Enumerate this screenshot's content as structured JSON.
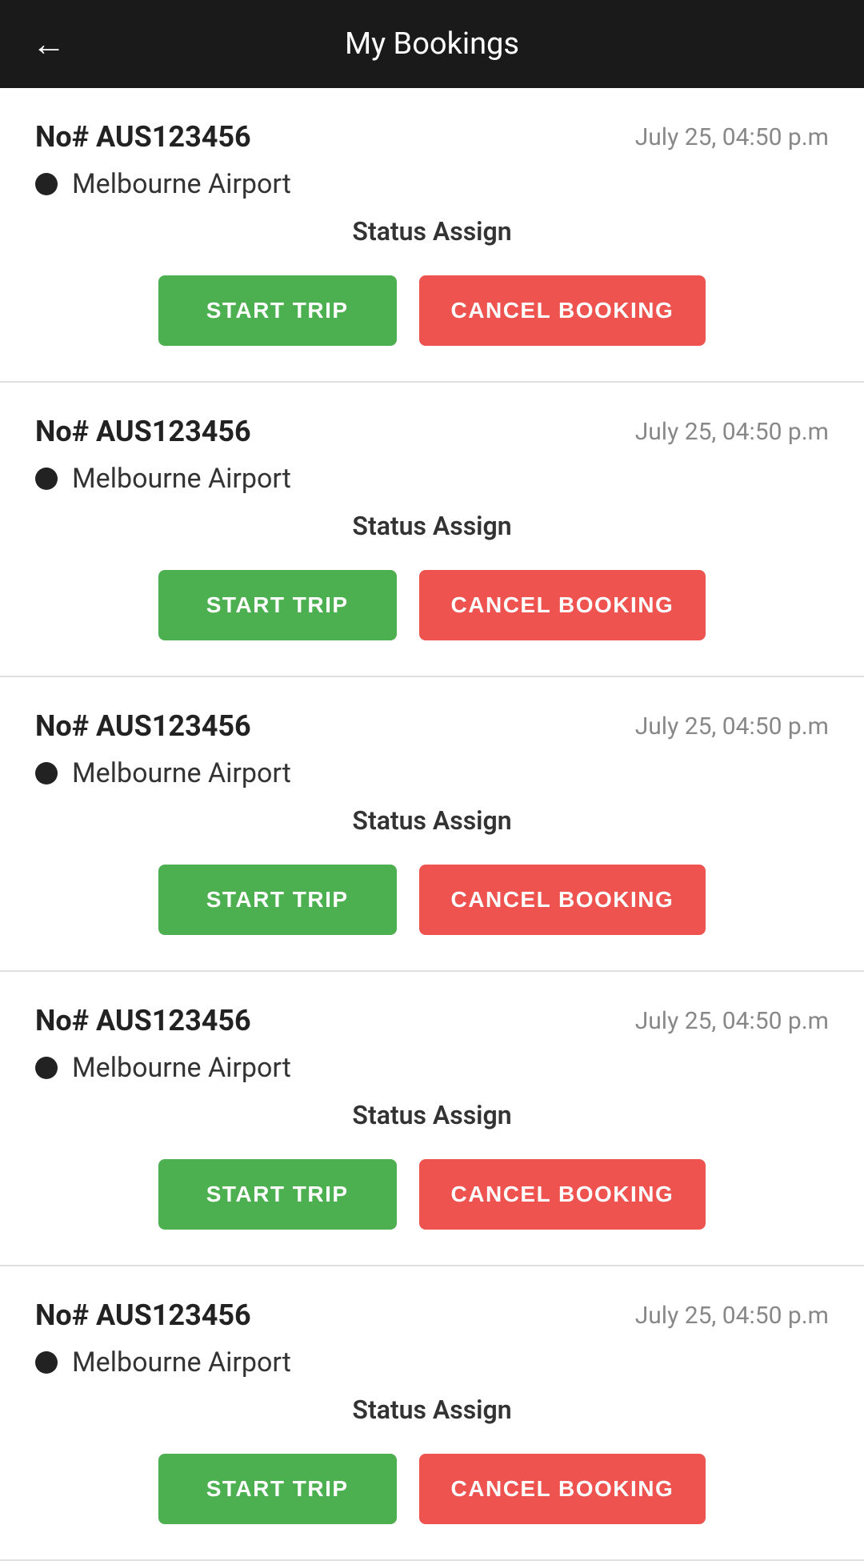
{
  "header": {
    "title": "My Bookings",
    "back_icon": "←"
  },
  "bookings": [
    {
      "id": "booking-1",
      "number": "No# AUS123456",
      "date": "July 25, 04:50 p.m",
      "location": "Melbourne Airport",
      "status": "Status Assign",
      "start_trip_label": "START TRIP",
      "cancel_booking_label": "CANCEL BOOKING"
    },
    {
      "id": "booking-2",
      "number": "No# AUS123456",
      "date": "July 25, 04:50 p.m",
      "location": "Melbourne Airport",
      "status": "Status Assign",
      "start_trip_label": "START TRIP",
      "cancel_booking_label": "CANCEL BOOKING"
    },
    {
      "id": "booking-3",
      "number": "No# AUS123456",
      "date": "July 25, 04:50 p.m",
      "location": "Melbourne Airport",
      "status": "Status Assign",
      "start_trip_label": "START TRIP",
      "cancel_booking_label": "CANCEL BOOKING"
    },
    {
      "id": "booking-4",
      "number": "No# AUS123456",
      "date": "July 25, 04:50 p.m",
      "location": "Melbourne Airport",
      "status": "Status Assign",
      "start_trip_label": "START TRIP",
      "cancel_booking_label": "CANCEL BOOKING"
    },
    {
      "id": "booking-5",
      "number": "No# AUS123456",
      "date": "July 25, 04:50 p.m",
      "location": "Melbourne Airport",
      "status": "Status Assign",
      "start_trip_label": "START TRIP",
      "cancel_booking_label": "CANCEL BOOKING"
    }
  ],
  "colors": {
    "header_bg": "#1a1a1a",
    "start_trip_bg": "#4caf50",
    "cancel_booking_bg": "#ef5350",
    "divider": "#e0e0e0",
    "dot_color": "#222222"
  }
}
